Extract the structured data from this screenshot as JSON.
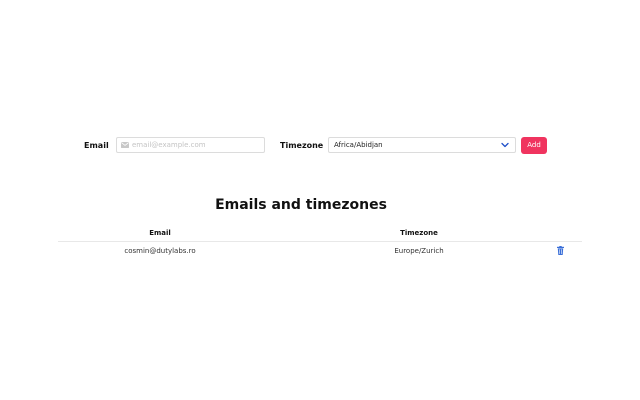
{
  "form": {
    "email_label": "Email",
    "email_placeholder": "email@example.com",
    "email_value": "",
    "email_icon": "mail-icon",
    "timezone_label": "Timezone",
    "timezone_value": "Africa/Abidjan",
    "timezone_chevron_icon": "chevron-down-icon",
    "add_label": "Add",
    "add_color": "#f0345f"
  },
  "section": {
    "title": "Emails and timezones"
  },
  "table": {
    "headers": {
      "email": "Email",
      "timezone": "Timezone"
    },
    "rows": [
      {
        "email": "cosmin@dutylabs.ro",
        "timezone": "Europe/Zurich",
        "delete_icon": "trash-icon"
      }
    ]
  },
  "colors": {
    "accent": "#f0345f",
    "icon_blue": "#3b6fd8"
  }
}
